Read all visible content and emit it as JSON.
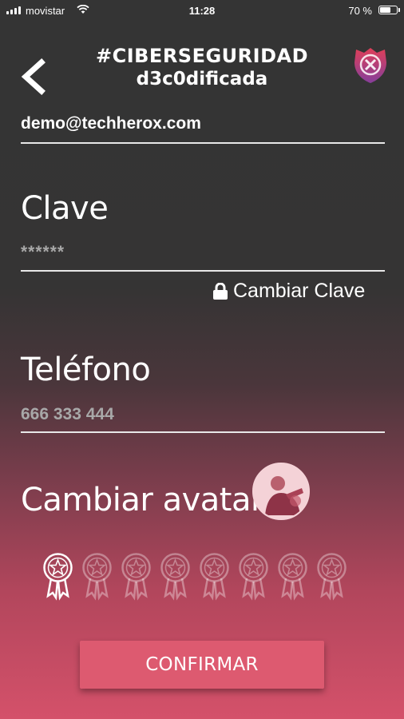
{
  "status_bar": {
    "carrier": "movistar",
    "time": "11:28",
    "battery_percent": "70 %",
    "battery_level": 0.7
  },
  "header": {
    "title_line1": "#CIBERSEGURIDAD",
    "title_line2": "d3c0dificada",
    "back_icon": "chevron-left-icon",
    "logo_icon": "shield-x-logo-icon"
  },
  "form": {
    "email": "demo@techherox.com",
    "password_label": "Clave",
    "password_value": "******",
    "change_password_label": "Cambiar Clave",
    "phone_label": "Teléfono",
    "phone_value": "666 333 444",
    "avatar_label": "Cambiar avatar"
  },
  "badges": {
    "total": 8,
    "unlocked": 1
  },
  "actions": {
    "confirm_label": "CONFIRMAR"
  },
  "colors": {
    "background_top": "#343434",
    "background_bottom": "#d4516a",
    "accent": "#dd5a70",
    "muted_text": "#a8a8a8"
  }
}
